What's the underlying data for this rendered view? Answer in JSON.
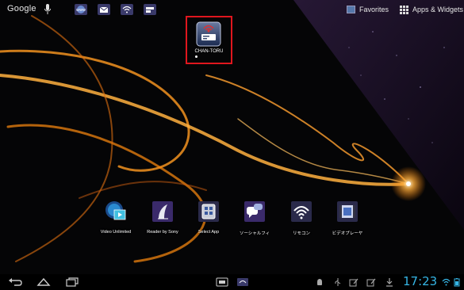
{
  "topbar": {
    "search_label": "Google",
    "favorites_label": "Favorites",
    "apps_label": "Apps & Widgets"
  },
  "homescreen": {
    "selected_shortcut": {
      "label": "CHAN-TORU"
    }
  },
  "dock_apps": [
    {
      "label": "Video Unlimited"
    },
    {
      "label": "Reader by Sony"
    },
    {
      "label": "Select App"
    },
    {
      "label": "ソーシャルフィ"
    },
    {
      "label": "リモコン"
    },
    {
      "label": "ビデオプレーヤ"
    }
  ],
  "systembar": {
    "clock": "17:23"
  },
  "colors": {
    "accent": "#35b5e5",
    "highlight_box": "#e0161e"
  }
}
